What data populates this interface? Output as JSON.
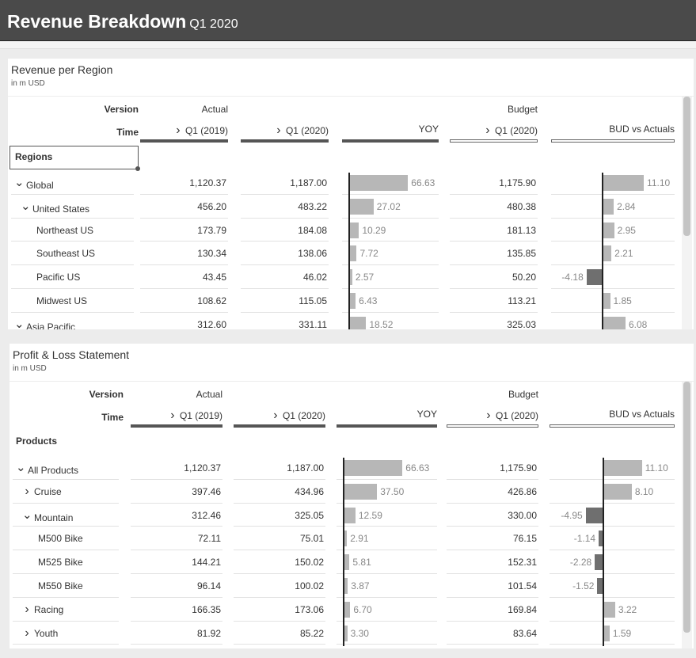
{
  "app": {
    "title": "Revenue Breakdown",
    "subtitle": "Q1 2020"
  },
  "widgets": [
    {
      "title": "Revenue per Region",
      "unit": "in m USD",
      "header": {
        "version_label": "Version",
        "time_label": "Time",
        "versions": [
          "Actual",
          "",
          "",
          "Budget",
          ""
        ],
        "times": [
          "Q1 (2019)",
          "Q1 (2020)",
          "YOY",
          "Q1 (2020)",
          "BUD vs Actuals"
        ]
      },
      "dimension": "Regions",
      "rows": [
        {
          "label": "Global",
          "indent": 0,
          "expander": "open",
          "actual_2019": "1,120.37",
          "actual_2020": "1,187.00",
          "yoy": 66.63,
          "yoy_label": "66.63",
          "budget_2020": "1,175.90",
          "bud_vs_act": 11.1,
          "bud_vs_act_label": "11.10"
        },
        {
          "label": "United States",
          "indent": 1,
          "expander": "open",
          "actual_2019": "456.20",
          "actual_2020": "483.22",
          "yoy": 27.02,
          "yoy_label": "27.02",
          "budget_2020": "480.38",
          "bud_vs_act": 2.84,
          "bud_vs_act_label": "2.84"
        },
        {
          "label": "Northeast US",
          "indent": 2,
          "expander": "none",
          "actual_2019": "173.79",
          "actual_2020": "184.08",
          "yoy": 10.29,
          "yoy_label": "10.29",
          "budget_2020": "181.13",
          "bud_vs_act": 2.95,
          "bud_vs_act_label": "2.95"
        },
        {
          "label": "Southeast US",
          "indent": 2,
          "expander": "none",
          "actual_2019": "130.34",
          "actual_2020": "138.06",
          "yoy": 7.72,
          "yoy_label": "7.72",
          "budget_2020": "135.85",
          "bud_vs_act": 2.21,
          "bud_vs_act_label": "2.21"
        },
        {
          "label": "Pacific US",
          "indent": 2,
          "expander": "none",
          "actual_2019": "43.45",
          "actual_2020": "46.02",
          "yoy": 2.57,
          "yoy_label": "2.57",
          "budget_2020": "50.20",
          "bud_vs_act": -4.18,
          "bud_vs_act_label": "-4.18"
        },
        {
          "label": "Midwest US",
          "indent": 2,
          "expander": "none",
          "actual_2019": "108.62",
          "actual_2020": "115.05",
          "yoy": 6.43,
          "yoy_label": "6.43",
          "budget_2020": "113.21",
          "bud_vs_act": 1.85,
          "bud_vs_act_label": "1.85"
        },
        {
          "label": "Asia Pacific",
          "indent": 0,
          "expander": "open",
          "actual_2019": "312.60",
          "actual_2020": "331.11",
          "yoy": 18.52,
          "yoy_label": "18.52",
          "budget_2020": "325.03",
          "bud_vs_act": 6.08,
          "bud_vs_act_label": "6.08"
        }
      ]
    },
    {
      "title": "Profit & Loss Statement",
      "unit": "in m USD",
      "header": {
        "version_label": "Version",
        "time_label": "Time",
        "versions": [
          "Actual",
          "",
          "",
          "Budget",
          ""
        ],
        "times": [
          "Q1 (2019)",
          "Q1 (2020)",
          "YOY",
          "Q1 (2020)",
          "BUD vs Actuals"
        ]
      },
      "dimension": "Products",
      "rows": [
        {
          "label": "All Products",
          "indent": 0,
          "expander": "open",
          "actual_2019": "1,120.37",
          "actual_2020": "1,187.00",
          "yoy": 66.63,
          "yoy_label": "66.63",
          "budget_2020": "1,175.90",
          "bud_vs_act": 11.1,
          "bud_vs_act_label": "11.10"
        },
        {
          "label": "Cruise",
          "indent": 1,
          "expander": "closed",
          "actual_2019": "397.46",
          "actual_2020": "434.96",
          "yoy": 37.5,
          "yoy_label": "37.50",
          "budget_2020": "426.86",
          "bud_vs_act": 8.1,
          "bud_vs_act_label": "8.10"
        },
        {
          "label": "Mountain",
          "indent": 1,
          "expander": "open",
          "actual_2019": "312.46",
          "actual_2020": "325.05",
          "yoy": 12.59,
          "yoy_label": "12.59",
          "budget_2020": "330.00",
          "bud_vs_act": -4.95,
          "bud_vs_act_label": "-4.95"
        },
        {
          "label": "M500 Bike",
          "indent": 2,
          "expander": "none",
          "actual_2019": "72.11",
          "actual_2020": "75.01",
          "yoy": 2.91,
          "yoy_label": "2.91",
          "budget_2020": "76.15",
          "bud_vs_act": -1.14,
          "bud_vs_act_label": "-1.14"
        },
        {
          "label": "M525 Bike",
          "indent": 2,
          "expander": "none",
          "actual_2019": "144.21",
          "actual_2020": "150.02",
          "yoy": 5.81,
          "yoy_label": "5.81",
          "budget_2020": "152.31",
          "bud_vs_act": -2.28,
          "bud_vs_act_label": "-2.28"
        },
        {
          "label": "M550 Bike",
          "indent": 2,
          "expander": "none",
          "actual_2019": "96.14",
          "actual_2020": "100.02",
          "yoy": 3.87,
          "yoy_label": "3.87",
          "budget_2020": "101.54",
          "bud_vs_act": -1.52,
          "bud_vs_act_label": "-1.52"
        },
        {
          "label": "Racing",
          "indent": 1,
          "expander": "closed",
          "actual_2019": "166.35",
          "actual_2020": "173.06",
          "yoy": 6.7,
          "yoy_label": "6.70",
          "budget_2020": "169.84",
          "bud_vs_act": 3.22,
          "bud_vs_act_label": "3.22"
        },
        {
          "label": "Youth",
          "indent": 1,
          "expander": "closed",
          "actual_2019": "81.92",
          "actual_2020": "85.22",
          "yoy": 3.3,
          "yoy_label": "3.30",
          "budget_2020": "83.64",
          "bud_vs_act": 1.59,
          "bud_vs_act_label": "1.59"
        }
      ]
    }
  ],
  "scrollbars": [
    {
      "position": 0.0,
      "visible_fraction": 0.6
    },
    {
      "position": 0.0,
      "visible_fraction": 0.94
    }
  ],
  "icons": {
    "expanded": "chevron-down-icon",
    "collapsed": "chevron-right-icon"
  },
  "colors": {
    "topbar": "#4a4a4a",
    "positive_bar": "#b7b7b7",
    "negative_bar": "#6f6f6f",
    "axis": "#222222"
  }
}
